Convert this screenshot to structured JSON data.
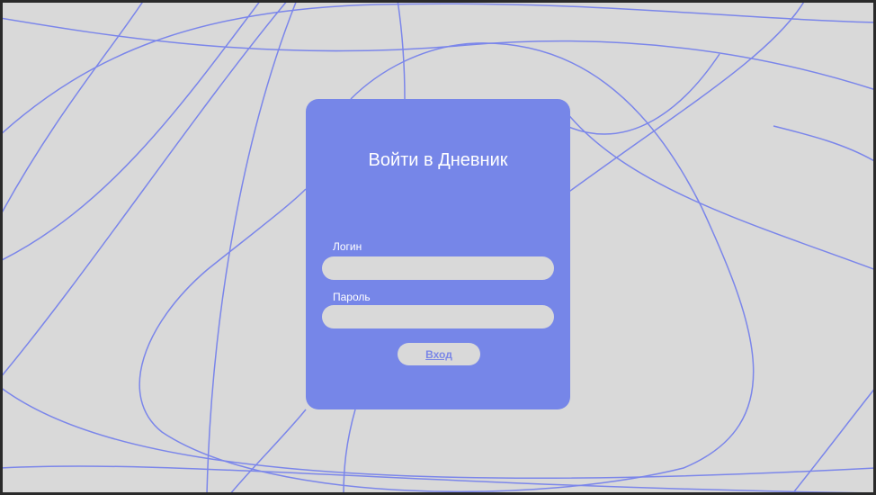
{
  "login_form": {
    "title": "Войти в Дневник",
    "login_label": "Логин",
    "login_value": "",
    "password_label": "Пароль",
    "password_value": "",
    "submit_label": "Вход"
  },
  "colors": {
    "background": "#d9d9d9",
    "card": "#7686e8",
    "lines": "#7b86ea",
    "frame": "#2a2a2a"
  }
}
